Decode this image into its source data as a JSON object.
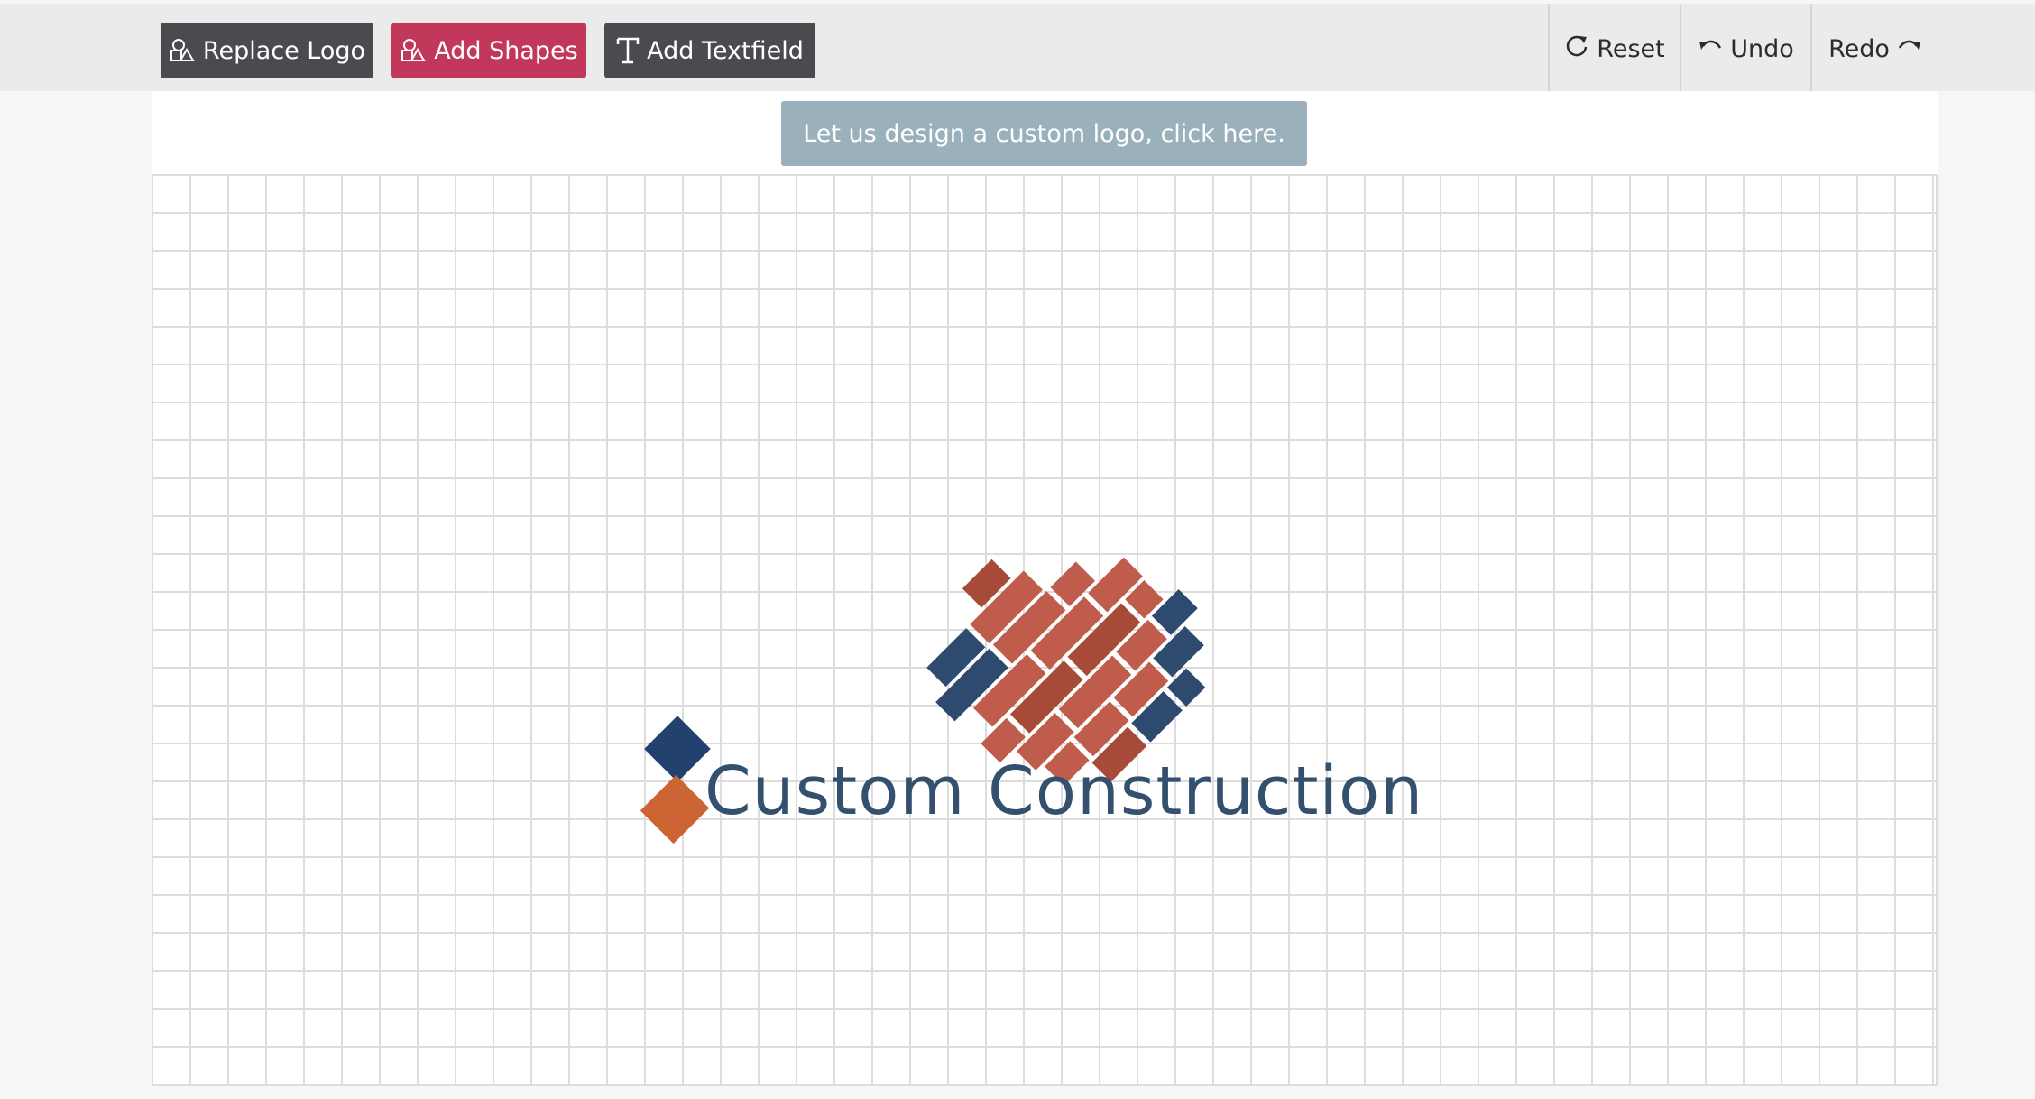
{
  "toolbar": {
    "replace_logo": "Replace Logo",
    "add_shapes": "Add Shapes",
    "add_textfield": "Add Textfield",
    "reset": "Reset",
    "undo": "Undo",
    "redo": "Redo"
  },
  "banner": {
    "text": "Let us design a custom logo, click here."
  },
  "logo": {
    "company_name": "Custom Construction",
    "colors": {
      "navy": "#2e4a6e",
      "brick": "#bf5c4c",
      "brick_dark": "#a84a38",
      "orange": "#cd6434",
      "text": "#33506f"
    }
  },
  "icons": [
    "shapes-icon",
    "text-icon",
    "reset-icon",
    "undo-icon",
    "redo-icon",
    "brick-wall-icon"
  ]
}
